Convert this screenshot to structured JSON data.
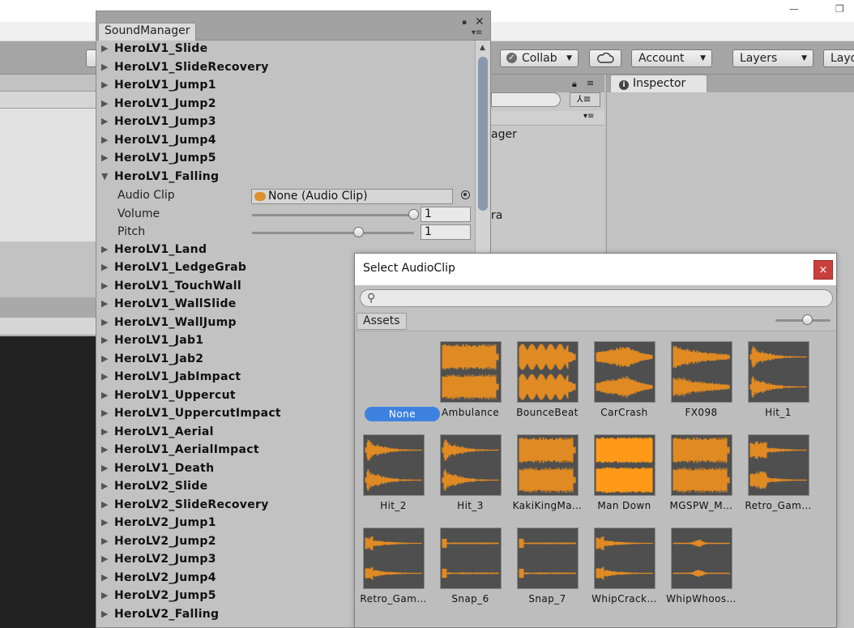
{
  "editor": {
    "collab_label": "Collab",
    "account_label": "Account",
    "layers_label": "Layers",
    "layout_label": "Layo",
    "inspector_tab": "Inspector",
    "hierarchy_text_1": "ager",
    "hierarchy_text_2": "ra",
    "window_minimize": "—",
    "window_restore": "❐"
  },
  "sound_manager": {
    "title": "SoundManager",
    "items": [
      {
        "name": "HeroLV1_Slide",
        "expanded": false
      },
      {
        "name": "HeroLV1_SlideRecovery",
        "expanded": false
      },
      {
        "name": "HeroLV1_Jump1",
        "expanded": false
      },
      {
        "name": "HeroLV1_Jump2",
        "expanded": false
      },
      {
        "name": "HeroLV1_Jump3",
        "expanded": false
      },
      {
        "name": "HeroLV1_Jump4",
        "expanded": false
      },
      {
        "name": "HeroLV1_Jump5",
        "expanded": false
      },
      {
        "name": "HeroLV1_Falling",
        "expanded": true
      },
      {
        "name": "HeroLV1_Land",
        "expanded": false
      },
      {
        "name": "HeroLV1_LedgeGrab",
        "expanded": false
      },
      {
        "name": "HeroLV1_TouchWall",
        "expanded": false
      },
      {
        "name": "HeroLV1_WallSlide",
        "expanded": false
      },
      {
        "name": "HeroLV1_WallJump",
        "expanded": false
      },
      {
        "name": "HeroLV1_Jab1",
        "expanded": false
      },
      {
        "name": "HeroLV1_Jab2",
        "expanded": false
      },
      {
        "name": "HeroLV1_JabImpact",
        "expanded": false
      },
      {
        "name": "HeroLV1_Uppercut",
        "expanded": false
      },
      {
        "name": "HeroLV1_UppercutImpact",
        "expanded": false
      },
      {
        "name": "HeroLV1_Aerial",
        "expanded": false
      },
      {
        "name": "HeroLV1_AerialImpact",
        "expanded": false
      },
      {
        "name": "HeroLV1_Death",
        "expanded": false
      },
      {
        "name": "HeroLV2_Slide",
        "expanded": false
      },
      {
        "name": "HeroLV2_SlideRecovery",
        "expanded": false
      },
      {
        "name": "HeroLV2_Jump1",
        "expanded": false
      },
      {
        "name": "HeroLV2_Jump2",
        "expanded": false
      },
      {
        "name": "HeroLV2_Jump3",
        "expanded": false
      },
      {
        "name": "HeroLV2_Jump4",
        "expanded": false
      },
      {
        "name": "HeroLV2_Jump5",
        "expanded": false
      },
      {
        "name": "HeroLV2_Falling",
        "expanded": false
      }
    ],
    "properties": {
      "audio_clip_label": "Audio Clip",
      "audio_clip_value": "None (Audio Clip)",
      "volume_label": "Volume",
      "volume_value": "1",
      "volume_level": 1.0,
      "pitch_label": "Pitch",
      "pitch_value": "1",
      "pitch_level": 0.66
    }
  },
  "dialog": {
    "title": "Select AudioClip",
    "close_label": "×",
    "search_placeholder": "",
    "assets_tab": "Assets",
    "none_label": "None",
    "assets": [
      {
        "label": "Ambulance",
        "wave": "dense"
      },
      {
        "label": "BounceBeat",
        "wave": "pulse"
      },
      {
        "label": "CarCrash",
        "wave": "burst"
      },
      {
        "label": "FX098",
        "wave": "decay"
      },
      {
        "label": "Hit_1",
        "wave": "hit"
      },
      {
        "label": "Hit_2",
        "wave": "hit"
      },
      {
        "label": "Hit_3",
        "wave": "hit"
      },
      {
        "label": "KakiKingMa…",
        "wave": "dense"
      },
      {
        "label": "Man Down",
        "wave": "loud"
      },
      {
        "label": "MGSPW_M…",
        "wave": "dense"
      },
      {
        "label": "Retro_Gam…",
        "wave": "blip"
      },
      {
        "label": "Retro_Gam…",
        "wave": "tail"
      },
      {
        "label": "Snap_6",
        "wave": "snap"
      },
      {
        "label": "Snap_7",
        "wave": "snap"
      },
      {
        "label": "WhipCrack…",
        "wave": "tail"
      },
      {
        "label": "WhipWhoos…",
        "wave": "whoosh"
      }
    ],
    "colors": {
      "wave": "#e08a23",
      "wave_loud": "#ff9a18",
      "thumb_bg": "#4f4f4f",
      "selected": "#3d82e0"
    }
  }
}
